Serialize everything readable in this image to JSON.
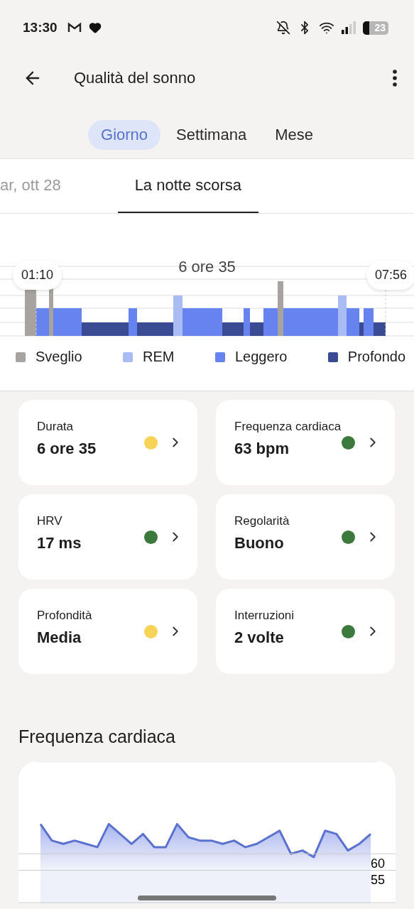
{
  "status_bar": {
    "time": "13:30",
    "battery": "23"
  },
  "header": {
    "title": "Qualità del sonno"
  },
  "period_tabs": [
    {
      "label": "Giorno",
      "selected": true
    },
    {
      "label": "Settimana",
      "selected": false
    },
    {
      "label": "Mese",
      "selected": false
    }
  ],
  "date_tabs": [
    {
      "label": "ar, ott 28",
      "selected": false
    },
    {
      "label": "La notte scorsa",
      "selected": true
    }
  ],
  "sleep_chart": {
    "start": "01:10",
    "end": "07:56",
    "total": "6 ore 35"
  },
  "legend": [
    {
      "label": "Sveglio",
      "color": "#a7a3a0"
    },
    {
      "label": "REM",
      "color": "#a9bdf4"
    },
    {
      "label": "Leggero",
      "color": "#6683f0"
    },
    {
      "label": "Profondo",
      "color": "#3a4b93"
    }
  ],
  "metrics": [
    {
      "label": "Durata",
      "value": "6 ore 35",
      "color": "#f7d458"
    },
    {
      "label": "Frequenza cardiaca",
      "value": "63 bpm",
      "color": "#3b7a3c"
    },
    {
      "label": "HRV",
      "value": "17 ms",
      "color": "#3b7a3c"
    },
    {
      "label": "Regolarità",
      "value": "Buono",
      "color": "#3b7a3c"
    },
    {
      "label": "Profondità",
      "value": "Media",
      "color": "#f7d458"
    },
    {
      "label": "Interruzioni",
      "value": "2 volte",
      "color": "#3b7a3c"
    }
  ],
  "heart_rate": {
    "title": "Frequenza cardiaca",
    "chart_data": {
      "type": "area",
      "ylim": [
        45,
        88
      ],
      "yticks": [
        55,
        60
      ],
      "series": [
        {
          "color": "#5a71d0",
          "values": [
            69,
            64,
            63,
            64,
            63,
            62,
            69,
            66,
            63,
            66,
            62,
            62,
            69,
            65,
            64,
            64,
            63,
            64,
            62,
            63,
            65,
            67,
            60,
            61,
            59,
            67,
            66,
            61,
            63,
            66
          ]
        }
      ]
    }
  }
}
